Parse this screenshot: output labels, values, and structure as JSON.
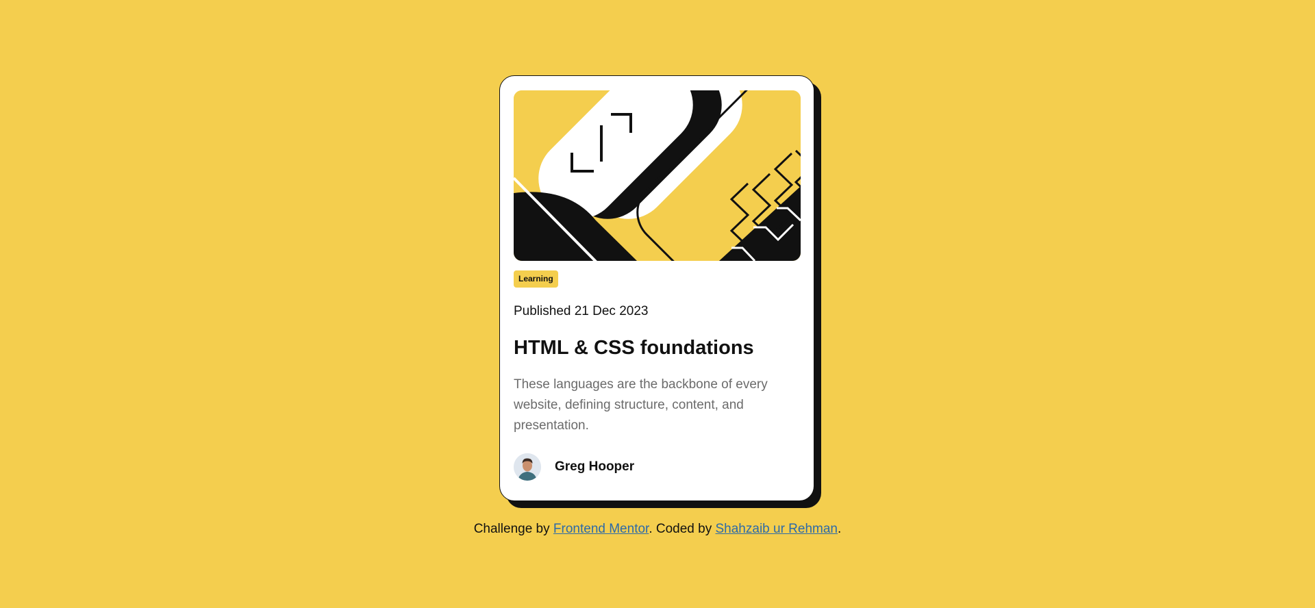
{
  "card": {
    "image": {
      "icon": "abstract-illustration"
    },
    "tag": "Learning",
    "published": "Published 21 Dec 2023",
    "title": "HTML & CSS foundations",
    "description": "These languages are the backbone of every website, defining structure, content, and presentation.",
    "author": {
      "name": "Greg Hooper",
      "avatar_icon": "avatar-photo"
    }
  },
  "attribution": {
    "prefix": "Challenge by ",
    "link1": "Frontend Mentor",
    "middle": ". Coded by ",
    "link2": "Shahzaib ur Rehman",
    "suffix": "."
  },
  "colors": {
    "background": "#F4CE4E",
    "card": "#FFFFFF",
    "ink": "#111111",
    "muted_text": "#6B6B6B",
    "link": "#2C6AA8"
  }
}
